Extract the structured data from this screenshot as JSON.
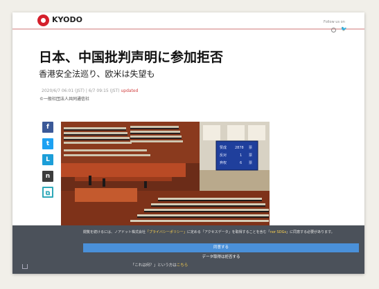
{
  "header": {
    "logo_text": "KYODO",
    "follow_label": "Follow us on",
    "icons": [
      "globe-icon",
      "twitter-icon"
    ]
  },
  "article": {
    "title": "日本、中国批判声明に参加拒否",
    "subtitle": "香港安全法巡り、欧米は失望も",
    "published": "2020/6/7 06:01 (JST)",
    "updated_time": "6/7 09:15 (JST)",
    "updated_label": "updated",
    "copyright": "©一般社団法人共同通信社"
  },
  "share": {
    "facebook": "f",
    "twitter": "t",
    "line": "L",
    "note": "n",
    "link": "⧉"
  },
  "photo_board": {
    "rows": [
      [
        "赞成",
        "2878",
        "票"
      ],
      [
        "反对",
        "1",
        "票"
      ],
      [
        "弃权",
        "6",
        "票"
      ]
    ]
  },
  "cookie": {
    "text_before": "閲覧を続けるには、ノアドット株式会社",
    "text_link1": "「プライバシーポリシー」",
    "text_mid": "に定める「アクセスデータ」を取得することを含む「",
    "text_link2": "nor SDGs",
    "text_after": "」に同意する必要があります。",
    "agree_label": "同意する",
    "settings_label": "データ取得は拒否する",
    "whatis_before": "「これは何？」という方は",
    "whatis_link": "こちら"
  }
}
